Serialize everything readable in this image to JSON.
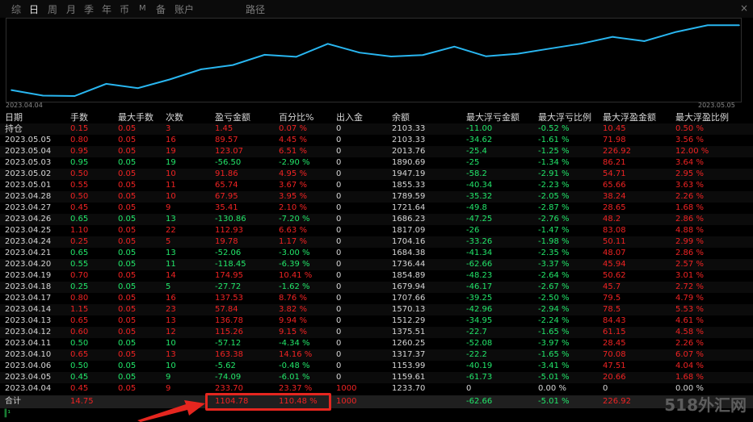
{
  "tabs": [
    {
      "label": "综",
      "active": false
    },
    {
      "label": "日",
      "active": true
    },
    {
      "label": "周",
      "active": false
    },
    {
      "label": "月",
      "active": false
    },
    {
      "label": "季",
      "active": false
    },
    {
      "label": "年",
      "active": false
    },
    {
      "label": "币",
      "active": false
    },
    {
      "label": "M",
      "active": false
    },
    {
      "label": "备",
      "active": false
    },
    {
      "label": "账户",
      "active": false
    },
    {
      "label": "路径",
      "active": false
    }
  ],
  "close_label": "×",
  "chart_data": {
    "type": "line",
    "x": [
      "2023.04.04",
      "2023.04.05",
      "2023.04.06",
      "2023.04.10",
      "2023.04.11",
      "2023.04.12",
      "2023.04.13",
      "2023.04.14",
      "2023.04.17",
      "2023.04.18",
      "2023.04.19",
      "2023.04.20",
      "2023.04.21",
      "2023.04.24",
      "2023.04.25",
      "2023.04.26",
      "2023.04.27",
      "2023.04.28",
      "2023.05.01",
      "2023.05.02",
      "2023.05.03",
      "2023.05.04",
      "2023.05.05",
      "持仓"
    ],
    "series": [
      {
        "values": [
          1233.7,
          1159.61,
          1153.99,
          1317.37,
          1260.25,
          1375.51,
          1512.29,
          1570.13,
          1707.66,
          1679.94,
          1854.89,
          1736.44,
          1684.38,
          1704.16,
          1817.09,
          1686.23,
          1721.64,
          1789.59,
          1855.33,
          1947.19,
          1890.69,
          2013.76,
          2103.33,
          2103.33
        ]
      }
    ],
    "x_start_label": "2023.04.04",
    "x_end_label": "2023.05.05",
    "ylim": [
      1100,
      2150
    ],
    "color": "#29b6f0"
  },
  "table": {
    "headers": [
      "日期",
      "手数",
      "最大手数",
      "次数",
      "盈亏金额",
      "百分比%",
      "出入金",
      "余额",
      "最大浮亏金额",
      "最大浮亏比例",
      "最大浮盈金额",
      "最大浮盈比例"
    ],
    "rows": [
      {
        "cells": [
          "持仓",
          "0.15",
          "0.05",
          "3",
          "1.45",
          "0.07 %",
          "0",
          "2103.33",
          "-11.00",
          "-0.52 %",
          "10.45",
          "0.50 %"
        ],
        "colors": [
          "white",
          "red",
          "red",
          "red",
          "red",
          "red",
          "white",
          "white",
          "green",
          "green",
          "red",
          "red"
        ]
      },
      {
        "cells": [
          "2023.05.05",
          "0.80",
          "0.05",
          "16",
          "89.57",
          "4.45 %",
          "0",
          "2103.33",
          "-34.62",
          "-1.61 %",
          "71.98",
          "3.56 %"
        ],
        "colors": [
          "white",
          "red",
          "red",
          "red",
          "red",
          "red",
          "white",
          "white",
          "green",
          "green",
          "red",
          "red"
        ]
      },
      {
        "cells": [
          "2023.05.04",
          "0.95",
          "0.05",
          "19",
          "123.07",
          "6.51 %",
          "0",
          "2013.76",
          "-25.4",
          "-1.25 %",
          "226.92",
          "12.00 %"
        ],
        "colors": [
          "white",
          "red",
          "red",
          "red",
          "red",
          "red",
          "white",
          "white",
          "green",
          "green",
          "red",
          "red"
        ]
      },
      {
        "cells": [
          "2023.05.03",
          "0.95",
          "0.05",
          "19",
          "-56.50",
          "-2.90 %",
          "0",
          "1890.69",
          "-25",
          "-1.34 %",
          "86.21",
          "3.64 %"
        ],
        "colors": [
          "white",
          "green",
          "green",
          "green",
          "green",
          "green",
          "white",
          "white",
          "green",
          "green",
          "red",
          "red"
        ]
      },
      {
        "cells": [
          "2023.05.02",
          "0.50",
          "0.05",
          "10",
          "91.86",
          "4.95 %",
          "0",
          "1947.19",
          "-58.2",
          "-2.91 %",
          "54.71",
          "2.95 %"
        ],
        "colors": [
          "white",
          "red",
          "red",
          "red",
          "red",
          "red",
          "white",
          "white",
          "green",
          "green",
          "red",
          "red"
        ]
      },
      {
        "cells": [
          "2023.05.01",
          "0.55",
          "0.05",
          "11",
          "65.74",
          "3.67 %",
          "0",
          "1855.33",
          "-40.34",
          "-2.23 %",
          "65.66",
          "3.63 %"
        ],
        "colors": [
          "white",
          "red",
          "red",
          "red",
          "red",
          "red",
          "white",
          "white",
          "green",
          "green",
          "red",
          "red"
        ]
      },
      {
        "cells": [
          "2023.04.28",
          "0.50",
          "0.05",
          "10",
          "67.95",
          "3.95 %",
          "0",
          "1789.59",
          "-35.32",
          "-2.05 %",
          "38.24",
          "2.26 %"
        ],
        "colors": [
          "white",
          "red",
          "red",
          "red",
          "red",
          "red",
          "white",
          "white",
          "green",
          "green",
          "red",
          "red"
        ]
      },
      {
        "cells": [
          "2023.04.27",
          "0.45",
          "0.05",
          "9",
          "35.41",
          "2.10 %",
          "0",
          "1721.64",
          "-49.8",
          "-2.87 %",
          "28.65",
          "1.68 %"
        ],
        "colors": [
          "white",
          "red",
          "red",
          "red",
          "red",
          "red",
          "white",
          "white",
          "green",
          "green",
          "red",
          "red"
        ]
      },
      {
        "cells": [
          "2023.04.26",
          "0.65",
          "0.05",
          "13",
          "-130.86",
          "-7.20 %",
          "0",
          "1686.23",
          "-47.25",
          "-2.76 %",
          "48.2",
          "2.86 %"
        ],
        "colors": [
          "white",
          "green",
          "green",
          "green",
          "green",
          "green",
          "white",
          "white",
          "green",
          "green",
          "red",
          "red"
        ]
      },
      {
        "cells": [
          "2023.04.25",
          "1.10",
          "0.05",
          "22",
          "112.93",
          "6.63 %",
          "0",
          "1817.09",
          "-26",
          "-1.47 %",
          "83.08",
          "4.88 %"
        ],
        "colors": [
          "white",
          "red",
          "red",
          "red",
          "red",
          "red",
          "white",
          "white",
          "green",
          "green",
          "red",
          "red"
        ]
      },
      {
        "cells": [
          "2023.04.24",
          "0.25",
          "0.05",
          "5",
          "19.78",
          "1.17 %",
          "0",
          "1704.16",
          "-33.26",
          "-1.98 %",
          "50.11",
          "2.99 %"
        ],
        "colors": [
          "white",
          "red",
          "red",
          "red",
          "red",
          "red",
          "white",
          "white",
          "green",
          "green",
          "red",
          "red"
        ]
      },
      {
        "cells": [
          "2023.04.21",
          "0.65",
          "0.05",
          "13",
          "-52.06",
          "-3.00 %",
          "0",
          "1684.38",
          "-41.34",
          "-2.35 %",
          "48.07",
          "2.86 %"
        ],
        "colors": [
          "white",
          "green",
          "green",
          "green",
          "green",
          "green",
          "white",
          "white",
          "green",
          "green",
          "red",
          "red"
        ]
      },
      {
        "cells": [
          "2023.04.20",
          "0.55",
          "0.05",
          "11",
          "-118.45",
          "-6.39 %",
          "0",
          "1736.44",
          "-62.66",
          "-3.37 %",
          "45.94",
          "2.57 %"
        ],
        "colors": [
          "white",
          "green",
          "green",
          "green",
          "green",
          "green",
          "white",
          "white",
          "green",
          "green",
          "red",
          "red"
        ]
      },
      {
        "cells": [
          "2023.04.19",
          "0.70",
          "0.05",
          "14",
          "174.95",
          "10.41 %",
          "0",
          "1854.89",
          "-48.23",
          "-2.64 %",
          "50.62",
          "3.01 %"
        ],
        "colors": [
          "white",
          "red",
          "red",
          "red",
          "red",
          "red",
          "white",
          "white",
          "green",
          "green",
          "red",
          "red"
        ]
      },
      {
        "cells": [
          "2023.04.18",
          "0.25",
          "0.05",
          "5",
          "-27.72",
          "-1.62 %",
          "0",
          "1679.94",
          "-46.17",
          "-2.67 %",
          "45.7",
          "2.72 %"
        ],
        "colors": [
          "white",
          "green",
          "green",
          "green",
          "green",
          "green",
          "white",
          "white",
          "green",
          "green",
          "red",
          "red"
        ]
      },
      {
        "cells": [
          "2023.04.17",
          "0.80",
          "0.05",
          "16",
          "137.53",
          "8.76 %",
          "0",
          "1707.66",
          "-39.25",
          "-2.50 %",
          "79.5",
          "4.79 %"
        ],
        "colors": [
          "white",
          "red",
          "red",
          "red",
          "red",
          "red",
          "white",
          "white",
          "green",
          "green",
          "red",
          "red"
        ]
      },
      {
        "cells": [
          "2023.04.14",
          "1.15",
          "0.05",
          "23",
          "57.84",
          "3.82 %",
          "0",
          "1570.13",
          "-42.96",
          "-2.94 %",
          "78.5",
          "5.53 %"
        ],
        "colors": [
          "white",
          "red",
          "red",
          "red",
          "red",
          "red",
          "white",
          "white",
          "green",
          "green",
          "red",
          "red"
        ]
      },
      {
        "cells": [
          "2023.04.13",
          "0.65",
          "0.05",
          "13",
          "136.78",
          "9.94 %",
          "0",
          "1512.29",
          "-34.95",
          "-2.24 %",
          "84.43",
          "4.61 %"
        ],
        "colors": [
          "white",
          "red",
          "red",
          "red",
          "red",
          "red",
          "white",
          "white",
          "green",
          "green",
          "red",
          "red"
        ]
      },
      {
        "cells": [
          "2023.04.12",
          "0.60",
          "0.05",
          "12",
          "115.26",
          "9.15 %",
          "0",
          "1375.51",
          "-22.7",
          "-1.65 %",
          "61.15",
          "4.58 %"
        ],
        "colors": [
          "white",
          "red",
          "red",
          "red",
          "red",
          "red",
          "white",
          "white",
          "green",
          "green",
          "red",
          "red"
        ]
      },
      {
        "cells": [
          "2023.04.11",
          "0.50",
          "0.05",
          "10",
          "-57.12",
          "-4.34 %",
          "0",
          "1260.25",
          "-52.08",
          "-3.97 %",
          "28.45",
          "2.26 %"
        ],
        "colors": [
          "white",
          "green",
          "green",
          "green",
          "green",
          "green",
          "white",
          "white",
          "green",
          "green",
          "red",
          "red"
        ]
      },
      {
        "cells": [
          "2023.04.10",
          "0.65",
          "0.05",
          "13",
          "163.38",
          "14.16 %",
          "0",
          "1317.37",
          "-22.2",
          "-1.65 %",
          "70.08",
          "6.07 %"
        ],
        "colors": [
          "white",
          "red",
          "red",
          "red",
          "red",
          "red",
          "white",
          "white",
          "green",
          "green",
          "red",
          "red"
        ]
      },
      {
        "cells": [
          "2023.04.06",
          "0.50",
          "0.05",
          "10",
          "-5.62",
          "-0.48 %",
          "0",
          "1153.99",
          "-40.19",
          "-3.41 %",
          "47.51",
          "4.04 %"
        ],
        "colors": [
          "white",
          "green",
          "green",
          "green",
          "green",
          "green",
          "white",
          "white",
          "green",
          "green",
          "red",
          "red"
        ]
      },
      {
        "cells": [
          "2023.04.05",
          "0.45",
          "0.05",
          "9",
          "-74.09",
          "-6.01 %",
          "0",
          "1159.61",
          "-61.73",
          "-5.01 %",
          "20.66",
          "1.68 %"
        ],
        "colors": [
          "white",
          "green",
          "green",
          "green",
          "green",
          "green",
          "white",
          "white",
          "green",
          "green",
          "red",
          "red"
        ]
      },
      {
        "cells": [
          "2023.04.04",
          "0.45",
          "0.05",
          "9",
          "233.70",
          "23.37 %",
          "1000",
          "1233.70",
          "0",
          "0.00 %",
          "0",
          "0.00 %"
        ],
        "colors": [
          "white",
          "red",
          "red",
          "red",
          "red",
          "red",
          "red",
          "white",
          "white",
          "white",
          "white",
          "white"
        ]
      }
    ],
    "footer": {
      "cells": [
        "合计",
        "14.75",
        "",
        "",
        "1104.78",
        "110.48 %",
        "1000",
        "",
        "-62.66",
        "-5.01 %",
        "226.92",
        ""
      ],
      "colors": [
        "white",
        "red",
        "white",
        "white",
        "red",
        "red",
        "red",
        "white",
        "green",
        "green",
        "red",
        "white"
      ]
    }
  },
  "status_text": "║¹",
  "watermark": "518外汇网"
}
